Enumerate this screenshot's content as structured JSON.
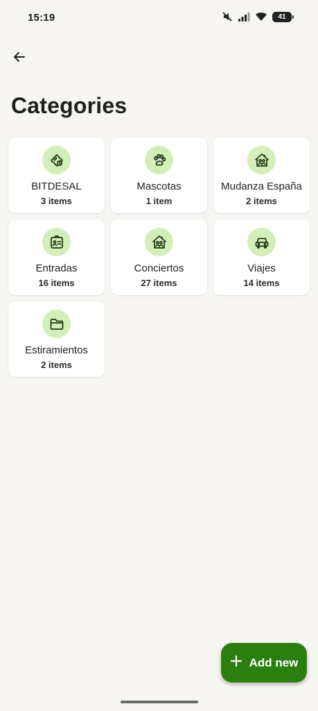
{
  "status_bar": {
    "time": "15:19",
    "battery": "41",
    "icons": [
      "mute-icon",
      "signal-icon",
      "wifi-icon",
      "battery-icon"
    ]
  },
  "header": {
    "back_icon": "arrow-left-icon",
    "title": "Categories"
  },
  "categories": [
    {
      "name": "BITDESAL",
      "count": "3 items",
      "icon": "ticket-icon"
    },
    {
      "name": "Mascotas",
      "count": "1 item",
      "icon": "paw-icon"
    },
    {
      "name": "Mudanza España",
      "count": "2 items",
      "icon": "home-people-icon"
    },
    {
      "name": "Entradas",
      "count": "16 items",
      "icon": "id-card-icon"
    },
    {
      "name": "Conciertos",
      "count": "27 items",
      "icon": "home-people-icon"
    },
    {
      "name": "Viajes",
      "count": "14 items",
      "icon": "car-icon"
    },
    {
      "name": "Estiramientos",
      "count": "2 items",
      "icon": "folder-icon"
    }
  ],
  "fab": {
    "label": "Add new",
    "icon": "plus-icon"
  },
  "colors": {
    "background": "#f6f5f1",
    "card": "#ffffff",
    "icon_circle": "#d3eeb9",
    "icon_stroke": "#1d3a12",
    "accent": "#2b7f10"
  }
}
